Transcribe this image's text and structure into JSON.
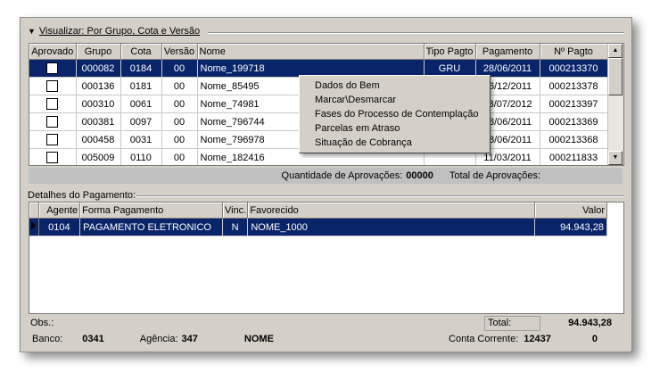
{
  "view_header": {
    "label": "Visualizar: Por Grupo, Cota e Versão"
  },
  "approvals_table": {
    "columns": [
      "Aprovado",
      "Grupo",
      "Cota",
      "Versão",
      "Nome",
      "Tipo Pagto",
      "Pagamento",
      "Nº Pagto"
    ],
    "rows": [
      {
        "grupo": "000082",
        "cota": "0184",
        "versao": "00",
        "nome": "Nome_199718",
        "tipo": "GRU",
        "pagamento": "28/06/2011",
        "npagto": "000213370"
      },
      {
        "grupo": "000136",
        "cota": "0181",
        "versao": "00",
        "nome": "Nome_85495",
        "tipo": "",
        "pagamento": "16/12/2011",
        "npagto": "000213378"
      },
      {
        "grupo": "000310",
        "cota": "0061",
        "versao": "00",
        "nome": "Nome_74981",
        "tipo": "",
        "pagamento": "13/07/2012",
        "npagto": "000213397"
      },
      {
        "grupo": "000381",
        "cota": "0097",
        "versao": "00",
        "nome": "Nome_796744",
        "tipo": "",
        "pagamento": "28/06/2011",
        "npagto": "000213369"
      },
      {
        "grupo": "000458",
        "cota": "0031",
        "versao": "00",
        "nome": "Nome_796978",
        "tipo": "",
        "pagamento": "28/06/2011",
        "npagto": "000213368"
      },
      {
        "grupo": "005009",
        "cota": "0110",
        "versao": "00",
        "nome": "Nome_182416",
        "tipo": "",
        "pagamento": "11/03/2011",
        "npagto": "000211833"
      }
    ]
  },
  "summary": {
    "qtd_label": "Quantidade de Aprovações:",
    "qtd_value": "00000",
    "total_label": "Total de Aprovações:"
  },
  "details": {
    "label": "Detalhes do Pagamento:",
    "columns": [
      "Agente",
      "Forma Pagamento",
      "Vinc.",
      "Favorecido",
      "Valor"
    ],
    "rows": [
      {
        "agente": "0104",
        "forma": "PAGAMENTO ELETRONICO",
        "vinc": "N",
        "favorecido": "NOME_1000",
        "valor": "94.943,28"
      }
    ]
  },
  "obs": {
    "label": "Obs.:",
    "total_label": "Total:",
    "total_value": "94.943,28"
  },
  "bank": {
    "banco_label": "Banco:",
    "banco_value": "0341",
    "agencia_label": "Agência:",
    "agencia_value": "347",
    "name": "NOME",
    "conta_label": "Conta Corrente:",
    "conta_value": "12437",
    "digit": "0"
  },
  "context_menu": {
    "items": [
      "Dados do Bem",
      "Marcar\\Desmarcar",
      "Fases do Processo de Contemplação",
      "Parcelas em Atraso",
      "Situação de Cobrança"
    ]
  }
}
